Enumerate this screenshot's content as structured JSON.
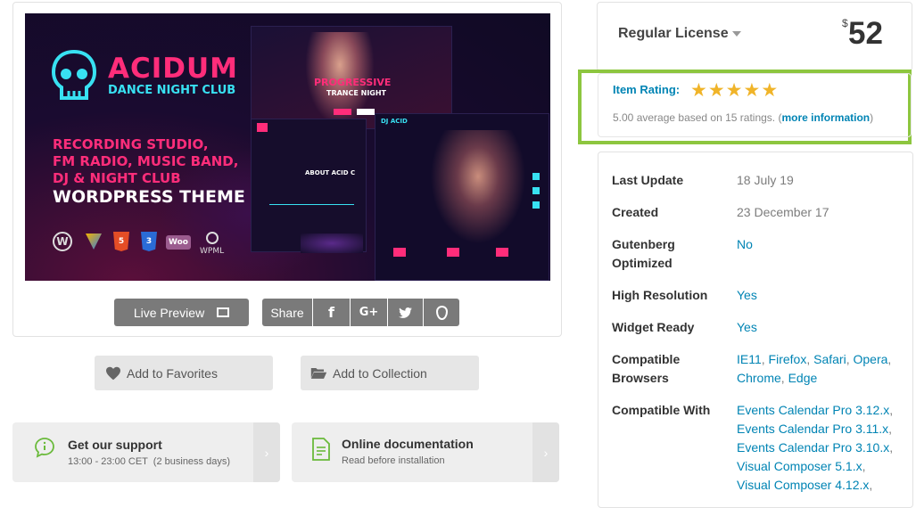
{
  "banner": {
    "brand": "ACIDUM",
    "brand_sub": "DANCE NIGHT CLUB",
    "feature_lines": [
      "RECORDING STUDIO,",
      "FM RADIO, MUSIC BAND,",
      "DJ & NIGHT CLUB"
    ],
    "theme_label": "WORDPRESS THEME",
    "logo_labels": [
      "WPML"
    ],
    "shot_headline": "PROGRESSIVE",
    "shot_sub": "TRANCE NIGHT",
    "shot_about": "ABOUT ACID C",
    "shot_dj": "DJ ACID"
  },
  "preview_actions": {
    "live_preview": "Live Preview",
    "share": "Share"
  },
  "collection": {
    "favorites": "Add to Favorites",
    "collection": "Add to Collection"
  },
  "support": {
    "title": "Get our support",
    "subtitle": "13:00 - 23:00 CET  (2 business days)",
    "docs_title": "Online documentation",
    "docs_subtitle": "Read before installation"
  },
  "license": {
    "name": "Regular License",
    "currency": "$",
    "price": "52"
  },
  "rating": {
    "label": "Item Rating:",
    "stars": 5,
    "summary": "5.00 average based on 15 ratings. (",
    "more_link": "more information",
    "summary_end": ")"
  },
  "meta": {
    "last_update_label": "Last Update",
    "last_update_value": "18 July 19",
    "created_label": "Created",
    "created_value": "23 December 17",
    "gutenberg_label_1": "Gutenberg",
    "gutenberg_label_2": "Optimized",
    "gutenberg_value": "No",
    "hires_label": "High Resolution",
    "hires_value": "Yes",
    "widget_label": "Widget Ready",
    "widget_value": "Yes",
    "browsers_label_1": "Compatible",
    "browsers_label_2": "Browsers",
    "browsers": [
      "IE11",
      "Firefox",
      "Safari",
      "Opera",
      "Chrome",
      "Edge"
    ],
    "compat_label": "Compatible With",
    "compat": [
      "Events Calendar Pro 3.12.x",
      "Events Calendar Pro 3.11.x",
      "Events Calendar Pro 3.10.x",
      "Visual Composer 5.1.x",
      "Visual Composer 4.12.x"
    ]
  },
  "colors": {
    "accent_link": "#0084b4",
    "rating_highlight": "#8dc63f",
    "star": "#f0b429",
    "banner_pink": "#ff2d7a",
    "banner_cyan": "#38e1f2"
  }
}
